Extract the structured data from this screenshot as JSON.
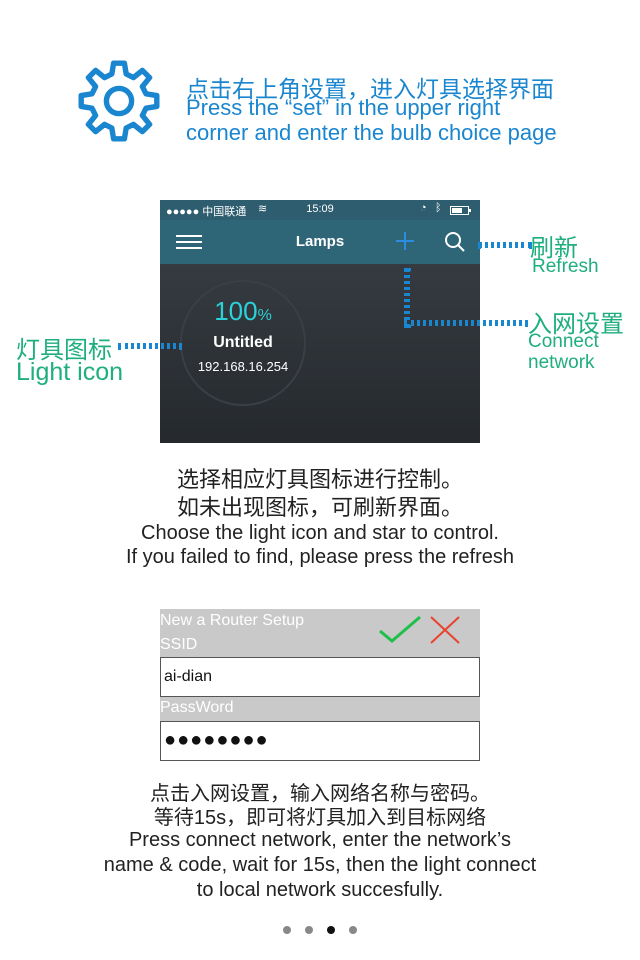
{
  "intro": {
    "cn": "点击右上角设置，进入灯具选择界面",
    "en1": "Press the “set” in the upper right",
    "en2": "corner and enter the bulb choice page"
  },
  "phone": {
    "status": {
      "carrier": "●●●●● 中国联通",
      "time": "15:09"
    },
    "nav_title": "Lamps",
    "lamp": {
      "percent": "100",
      "percent_sign": "%",
      "name": "Untitled",
      "ip": "192.168.16.254"
    }
  },
  "callouts": {
    "refresh_cn": "刷新",
    "refresh_en": "Refresh",
    "connect_cn": "入网设置",
    "connect_en1": "Connect",
    "connect_en2": "network",
    "light_cn": "灯具图标",
    "light_en": "Light icon"
  },
  "middle": {
    "cn1": "选择相应灯具图标进行控制。",
    "cn2": "如未出现图标，可刷新界面。",
    "en1": "Choose the light icon and star to control.",
    "en2": "If you failed to find, please press the refresh"
  },
  "router_form": {
    "title": "New a Router Setup",
    "ssid_label": "SSID",
    "ssid_value": "ai-dian",
    "password_label": "PassWord",
    "password_value": "●●●●●●●●"
  },
  "bottom": {
    "cn1": "点击入网设置，输入网络名称与密码。",
    "cn2": "等待15s，即可将灯具加入到目标网络",
    "en1": "Press connect network, enter the network’s",
    "en2": "name & code, wait for 15s, then the light connect",
    "en3": "to local network succesfully."
  },
  "pager": {
    "count": 4,
    "active_index": 2
  },
  "colors": {
    "accent_blue": "#1a86cf",
    "accent_green": "#1fae7e",
    "lamp_percent": "#2bd1d8"
  }
}
